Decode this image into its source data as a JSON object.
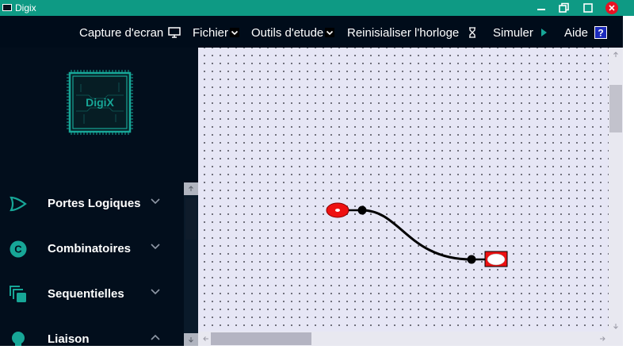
{
  "window": {
    "title": "Digix"
  },
  "menu": {
    "items": [
      {
        "label": "Capture d'ecran",
        "icon": "monitor-icon"
      },
      {
        "label": "Fichier",
        "icon": "chevron-down-icon"
      },
      {
        "label": "Outils d'etude",
        "icon": "chevron-down-icon"
      },
      {
        "label": "Reinisialiser l'horloge",
        "icon": "hourglass-icon"
      },
      {
        "label": "Simuler",
        "icon": "play-icon"
      },
      {
        "label": "Aide",
        "icon": "help-icon"
      }
    ]
  },
  "sidebar": {
    "logo_text": "DigiX",
    "categories": [
      {
        "label": "Portes Logiques",
        "icon": "logic-gate-icon",
        "expanded": false
      },
      {
        "label": "Combinatoires",
        "icon": "combinational-c-icon",
        "expanded": false
      },
      {
        "label": "Sequentielles",
        "icon": "stacked-squares-icon",
        "expanded": false
      },
      {
        "label": "Liaison",
        "icon": "lightbulb-icon",
        "expanded": true
      }
    ]
  },
  "colors": {
    "titlebar": "#0e9a84",
    "menubar": "#000c1a",
    "sidebar": "#020e1c",
    "accent": "#17a697",
    "canvas": "#e6e6f5",
    "component_red": "#ee1111",
    "close_button": "#e81123"
  },
  "canvas": {
    "components": [
      {
        "type": "input-toggle",
        "state": "off"
      },
      {
        "type": "output-led",
        "state": "off"
      }
    ],
    "wires": 1
  }
}
